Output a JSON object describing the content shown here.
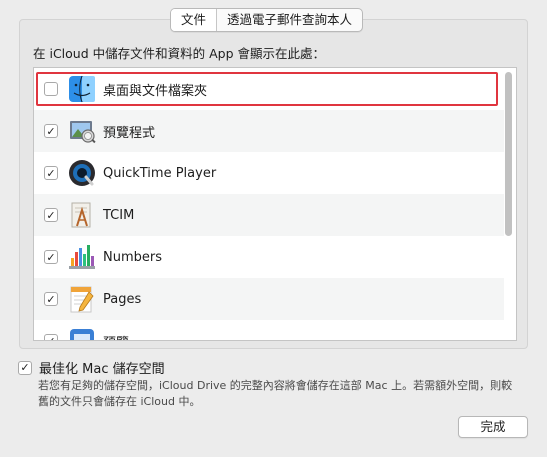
{
  "tabs": [
    {
      "label": "文件",
      "active": true
    },
    {
      "label": "透過電子郵件查詢本人",
      "active": false
    }
  ],
  "description": "在 iCloud 中儲存文件和資料的 App 會顯示在此處：",
  "apps": [
    {
      "name": "桌面與文件檔案夾",
      "checked": false,
      "icon": "finder-icon"
    },
    {
      "name": "預覽程式",
      "checked": true,
      "icon": "preview-icon"
    },
    {
      "name": "QuickTime Player",
      "checked": true,
      "icon": "quicktime-icon"
    },
    {
      "name": "TCIM",
      "checked": true,
      "icon": "tcim-icon"
    },
    {
      "name": "Numbers",
      "checked": true,
      "icon": "numbers-icon"
    },
    {
      "name": "Pages",
      "checked": true,
      "icon": "pages-icon"
    },
    {
      "name": "預覽",
      "checked": true,
      "icon": "app-icon"
    }
  ],
  "optimize": {
    "label": "最佳化 Mac 儲存空間",
    "checked": true,
    "info_line1": "若您有足夠的儲存空間，iCloud Drive 的完整內容將會儲存在這部 Mac 上。若需額外空間，則較",
    "info_line2": "舊的文件只會儲存在 iCloud 中。"
  },
  "done_button": "完成",
  "colors": {
    "highlight": "#e0353f",
    "row_alt": "#f4f5f5",
    "window_bg": "#ececec"
  }
}
